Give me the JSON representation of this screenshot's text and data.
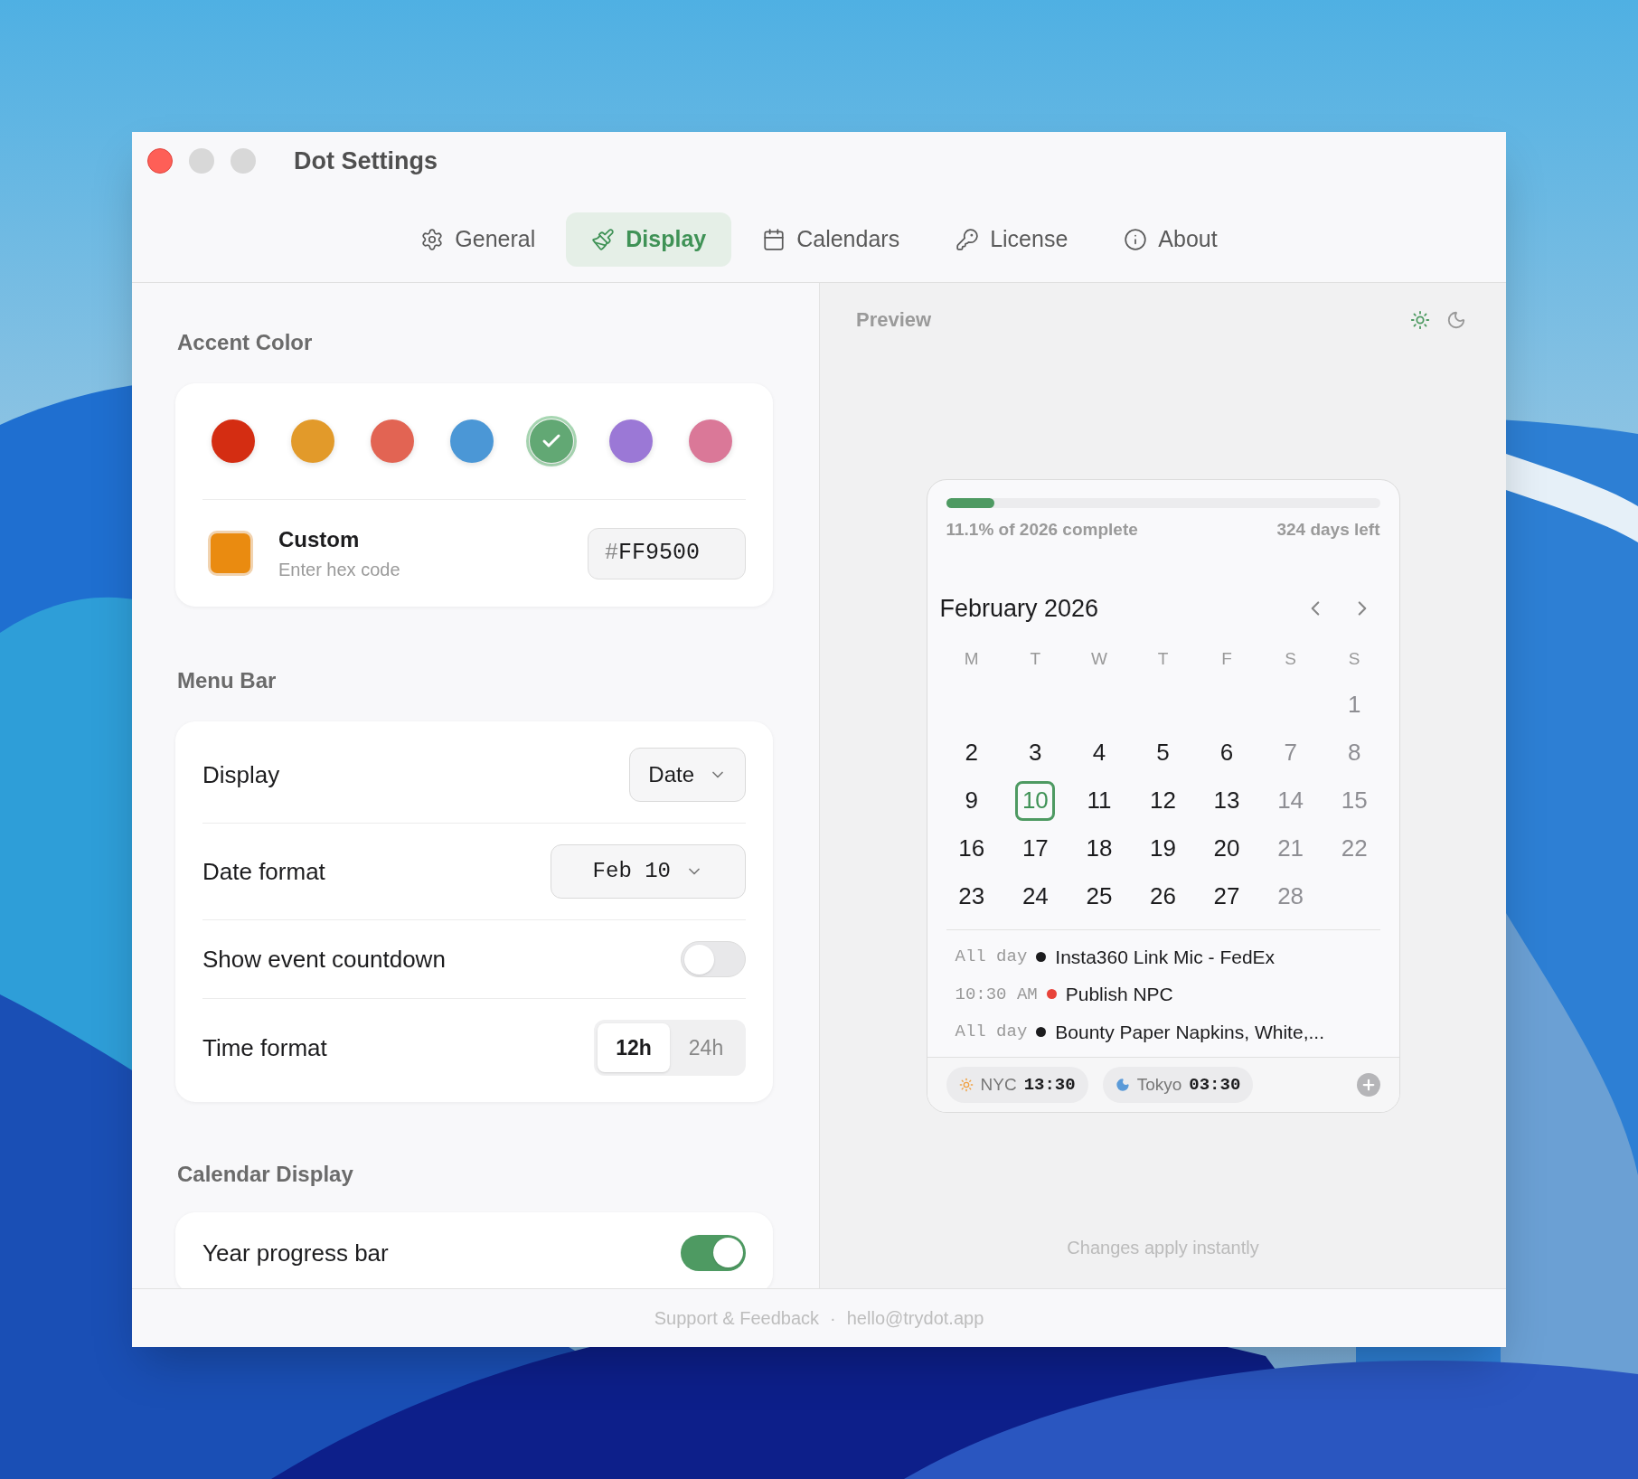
{
  "window": {
    "title": "Dot Settings"
  },
  "tabs": [
    {
      "label": "General",
      "selected": false
    },
    {
      "label": "Display",
      "selected": true
    },
    {
      "label": "Calendars",
      "selected": false
    },
    {
      "label": "License",
      "selected": false
    },
    {
      "label": "About",
      "selected": false
    }
  ],
  "accent": {
    "heading": "Accent Color",
    "swatches": [
      {
        "color": "#d42d12",
        "selected": false
      },
      {
        "color": "#e29a2a",
        "selected": false
      },
      {
        "color": "#e26453",
        "selected": false
      },
      {
        "color": "#4b97d6",
        "selected": false
      },
      {
        "color": "#62a874",
        "selected": true
      },
      {
        "color": "#9b78d6",
        "selected": false
      },
      {
        "color": "#da7898",
        "selected": false
      }
    ],
    "custom": {
      "label": "Custom",
      "hint": "Enter hex code",
      "color": "#ea8b10",
      "prefix": "#",
      "value": "FF9500"
    }
  },
  "menu_bar": {
    "heading": "Menu Bar",
    "rows": [
      {
        "kind": "select",
        "label": "Display",
        "value": "Date",
        "mono": false
      },
      {
        "kind": "select",
        "label": "Date format",
        "value": "Feb 10",
        "mono": true
      },
      {
        "kind": "toggle",
        "label": "Show event countdown",
        "on": false
      },
      {
        "kind": "segmented",
        "label": "Time format",
        "options": [
          {
            "label": "12h",
            "selected": true
          },
          {
            "label": "24h",
            "selected": false
          }
        ]
      }
    ]
  },
  "calendar_display": {
    "heading": "Calendar Display",
    "rows": [
      {
        "kind": "toggle",
        "label": "Year progress bar",
        "on": true
      }
    ]
  },
  "preview": {
    "heading": "Preview",
    "themes": [
      {
        "kind": "light",
        "selected": true
      },
      {
        "kind": "dark",
        "selected": false
      }
    ],
    "progress": {
      "level": 0.111,
      "caption": "11.1% of 2026 complete",
      "remaining": "324 days left"
    },
    "month": "February 2026",
    "weekdays": [
      "M",
      "T",
      "W",
      "T",
      "F",
      "S",
      "S"
    ],
    "weeks": [
      [
        {
          "label": "1",
          "muted": true,
          "selected": false
        }
      ],
      [
        {
          "label": "2",
          "muted": false,
          "selected": false
        },
        {
          "label": "3",
          "muted": false,
          "selected": false
        },
        {
          "label": "4",
          "muted": false,
          "selected": false
        },
        {
          "label": "5",
          "muted": false,
          "selected": false
        },
        {
          "label": "6",
          "muted": false,
          "selected": false
        },
        {
          "label": "7",
          "muted": true,
          "selected": false
        },
        {
          "label": "8",
          "muted": true,
          "selected": false
        }
      ],
      [
        {
          "label": "9",
          "muted": false,
          "selected": false
        },
        {
          "label": "10",
          "muted": false,
          "selected": true
        },
        {
          "label": "11",
          "muted": false,
          "selected": false
        },
        {
          "label": "12",
          "muted": false,
          "selected": false
        },
        {
          "label": "13",
          "muted": false,
          "selected": false
        },
        {
          "label": "14",
          "muted": true,
          "selected": false
        },
        {
          "label": "15",
          "muted": true,
          "selected": false
        }
      ],
      [
        {
          "label": "16",
          "muted": false,
          "selected": false
        },
        {
          "label": "17",
          "muted": false,
          "selected": false
        },
        {
          "label": "18",
          "muted": false,
          "selected": false
        },
        {
          "label": "19",
          "muted": false,
          "selected": false
        },
        {
          "label": "20",
          "muted": false,
          "selected": false
        },
        {
          "label": "21",
          "muted": true,
          "selected": false
        },
        {
          "label": "22",
          "muted": true,
          "selected": false
        }
      ],
      [
        {
          "label": "23",
          "muted": false,
          "selected": false
        },
        {
          "label": "24",
          "muted": false,
          "selected": false
        },
        {
          "label": "25",
          "muted": false,
          "selected": false
        },
        {
          "label": "26",
          "muted": false,
          "selected": false
        },
        {
          "label": "27",
          "muted": false,
          "selected": false
        },
        {
          "label": "28",
          "muted": true,
          "selected": false
        }
      ]
    ],
    "events": [
      {
        "time": "All day",
        "title": "Insta360 Link Mic - FedEx",
        "color": "#1c1c1e"
      },
      {
        "time": "10:30 AM",
        "title": "Publish NPC",
        "color": "#e8433a"
      },
      {
        "time": "All day",
        "title": "Bounty Paper Napkins, White,...",
        "color": "#1c1c1e"
      }
    ],
    "clocks": [
      {
        "kind": "day",
        "city": "NYC",
        "time": "13:30"
      },
      {
        "kind": "night",
        "city": "Tokyo",
        "time": "03:30"
      }
    ],
    "note": "Changes apply instantly"
  },
  "footer": {
    "link": "Support & Feedback",
    "separator": "·",
    "email": "hello@trydot.app"
  }
}
